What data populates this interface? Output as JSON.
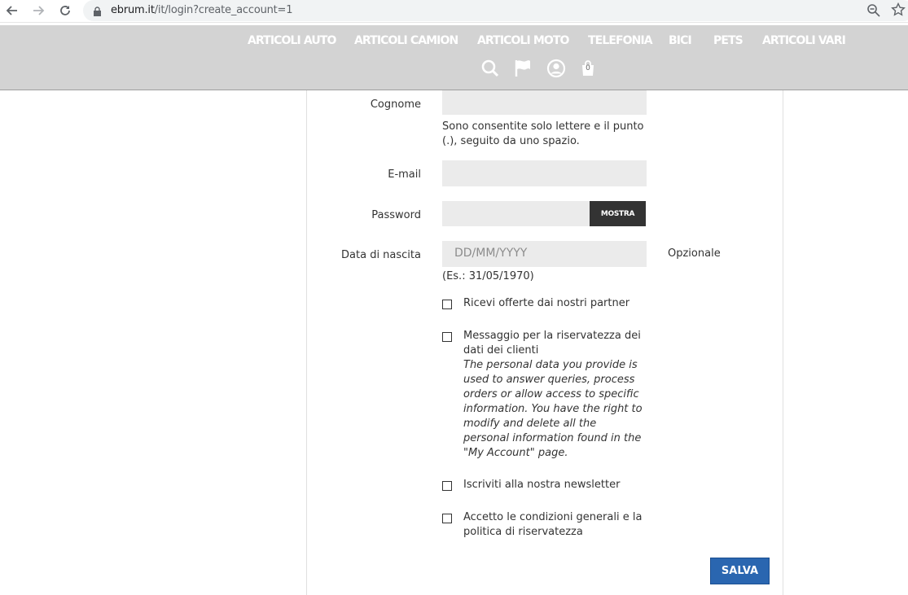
{
  "browser": {
    "url_domain": "ebrum.it",
    "url_path": "/it/login?create_account=1"
  },
  "header": {
    "menu": [
      "ARTICOLI AUTO",
      "ARTICOLI CAMION",
      "ARTICOLI MOTO",
      "TELEFONIA",
      "BICI",
      "PETS",
      "ARTICOLI VARI"
    ],
    "cart_count": "0",
    "icons": [
      "search-icon",
      "flag-icon",
      "user-icon",
      "cart-icon"
    ]
  },
  "form": {
    "cognome_label": "Cognome",
    "cognome_help": "Sono consentite solo lettere e il punto (.), seguito da uno spazio.",
    "email_label": "E-mail",
    "password_label": "Password",
    "show_password": "MOSTRA",
    "birthdate_label": "Data di nascita",
    "birthdate_placeholder": "DD/MM/YYYY",
    "birthdate_optional": "Opzionale",
    "birthdate_example": "(Es.: 31/05/1970)",
    "checkbox_partner": "Ricevi offerte dai nostri partner",
    "checkbox_privacy": "Messaggio per la riservatezza dei dati dei clienti",
    "privacy_text": "The personal data you provide is used to answer queries, process orders or allow access to specific information. You have the right to modify and delete all the personal information found in the \"My Account\" page.",
    "checkbox_newsletter": "Iscriviti alla nostra newsletter",
    "checkbox_terms": "Accetto le condizioni generali e la politica di riservatezza",
    "submit": "SALVA"
  },
  "colors": {
    "header_bg": "#d3d3d3",
    "field_bg": "#ebebeb",
    "button_dark": "#333333",
    "submit_blue": "#2a66b0"
  }
}
